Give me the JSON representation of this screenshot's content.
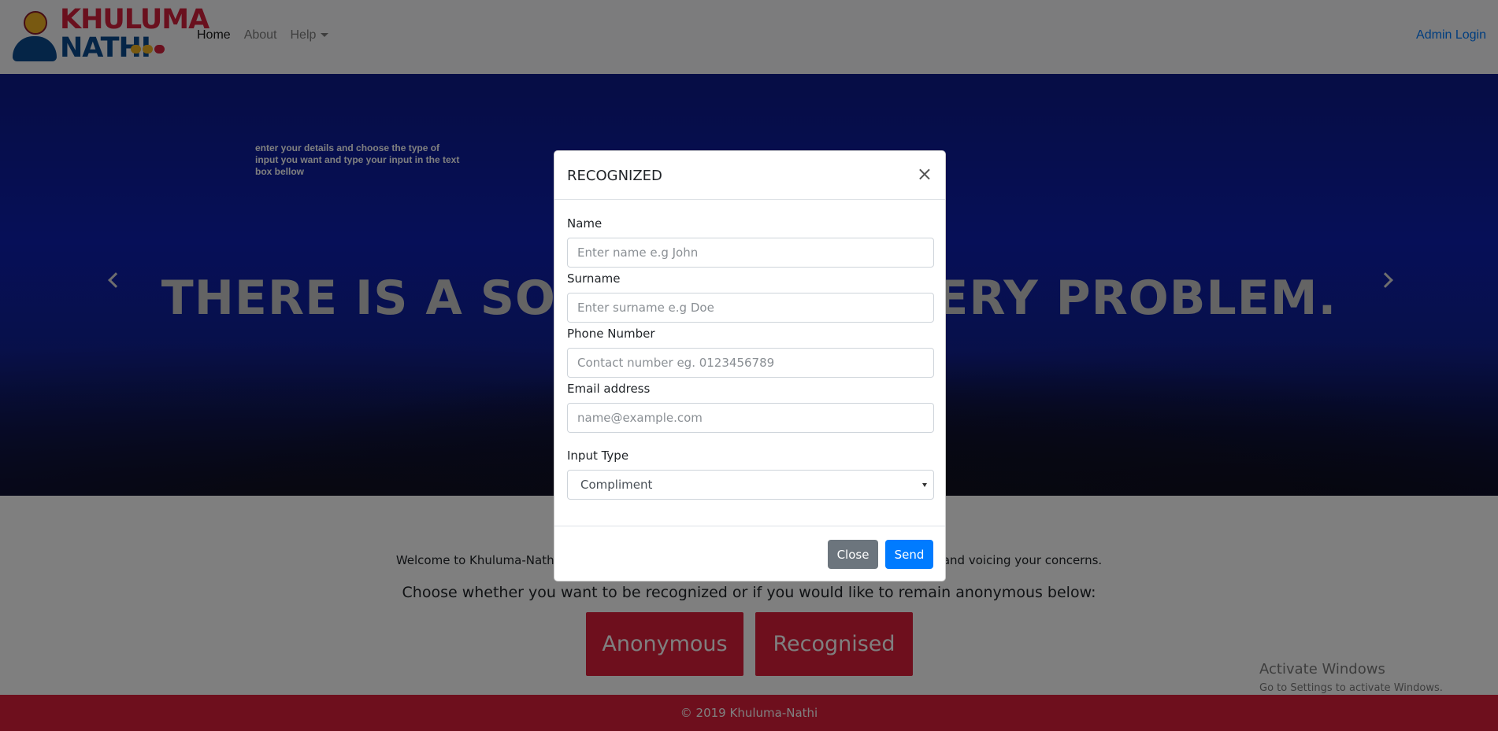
{
  "brand": {
    "line1": "KHULUMA",
    "line2": "NATHI",
    "colors": {
      "red": "#d4213d",
      "blue": "#0b4a8f",
      "yellow": "#f0b323"
    }
  },
  "nav": {
    "home": "Home",
    "about": "About",
    "help": "Help",
    "admin_login": "Admin Login"
  },
  "hero": {
    "note": "enter your details and choose the type of input you want and type your input in the text box bellow",
    "heading": "THERE IS A SOLUTION TO EVERY PROBLEM."
  },
  "main": {
    "welcome": "Welcome to Khuluma-Nathi, a website that provides a platform for effective communication and voicing your concerns.",
    "choose": "Choose whether you want to be recognized or if you would like to remain anonymous below:",
    "anonymous_label": "Anonymous",
    "recognised_label": "Recognised"
  },
  "watermark": {
    "line1": "Activate Windows",
    "line2": "Go to Settings to activate Windows."
  },
  "footer": {
    "copyright": "© 2019 Khuluma-Nathi"
  },
  "modal": {
    "title": "RECOGNIZED",
    "close_symbol": "×",
    "name_label": "Name",
    "name_placeholder": "Enter name e.g John",
    "surname_label": "Surname",
    "surname_placeholder": "Enter surname e.g Doe",
    "phone_label": "Phone Number",
    "phone_placeholder": "Contact number eg. 0123456789",
    "email_label": "Email address",
    "email_placeholder": "name@example.com",
    "input_type_label": "Input Type",
    "input_type_value": "Compliment",
    "close_button": "Close",
    "send_button": "Send"
  },
  "colors": {
    "accent_red": "#dc1e3a",
    "primary_blue": "#007bff",
    "secondary_gray": "#6c757d"
  }
}
